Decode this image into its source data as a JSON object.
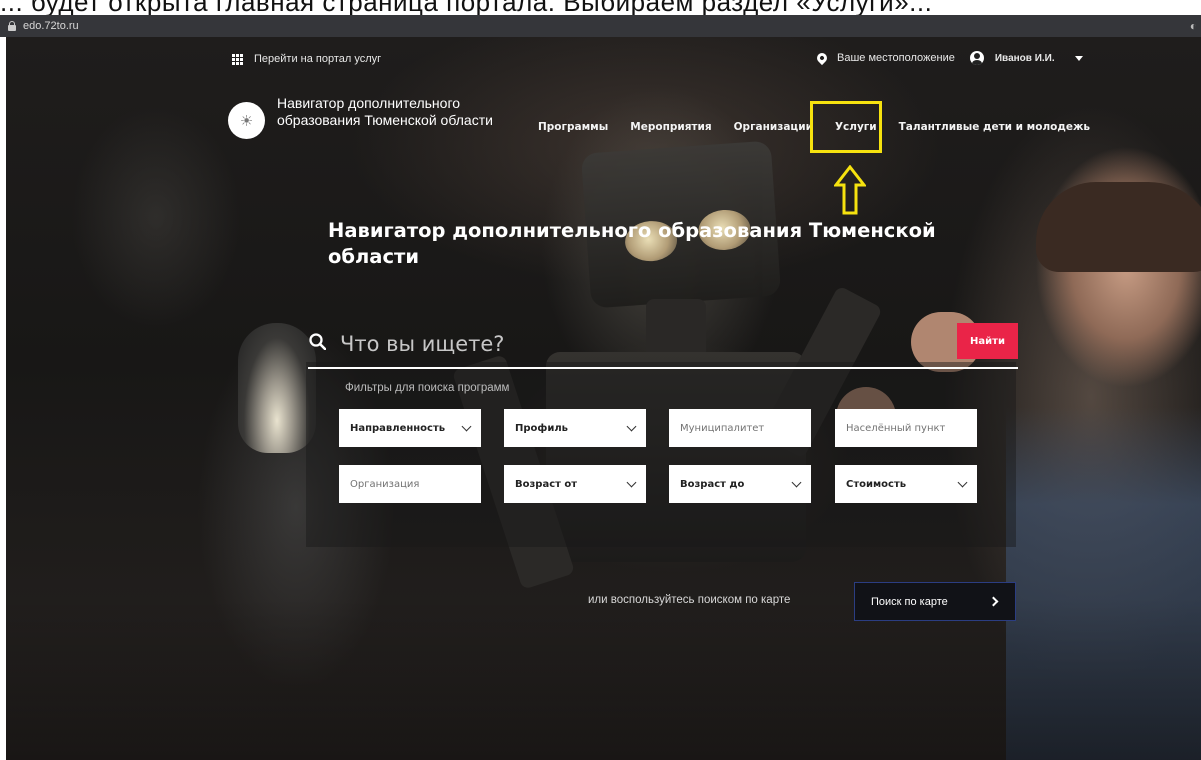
{
  "top_cut_text": "... будет открыта главная страница портала. Выбираем раздел «Услуги»...",
  "browser": {
    "url": "edo.72to.ru"
  },
  "topbar": {
    "portal_link": "Перейти на портал услуг",
    "location_label": "Ваше местоположение",
    "user_name": "Иванов И.И."
  },
  "site": {
    "title": "Навигатор дополнительного образования Тюменской области"
  },
  "nav": {
    "items": [
      {
        "label": "Программы"
      },
      {
        "label": "Мероприятия"
      },
      {
        "label": "Организации"
      },
      {
        "label": "Услуги"
      },
      {
        "label": "Талантливые дети и молодежь"
      }
    ]
  },
  "annotation": {
    "highlight_color": "#f6e20f"
  },
  "hero": {
    "title": "Навигатор дополнительного образования Тюменской области"
  },
  "search": {
    "placeholder": "Что вы ищете?",
    "button_label": "Найти",
    "button_color": "#ea2448"
  },
  "filters": {
    "label": "Фильтры для поиска программ",
    "items": [
      {
        "label": "Направленность"
      },
      {
        "label": "Профиль"
      },
      {
        "label": "Муниципалитет"
      },
      {
        "label": "Населённый пункт"
      },
      {
        "label": "Организация"
      },
      {
        "label": "Возраст от"
      },
      {
        "label": "Возраст до"
      },
      {
        "label": "Стоимость"
      }
    ]
  },
  "map": {
    "prompt": "или воспользуйтесь поиском по карте",
    "button_label": "Поиск по карте"
  }
}
